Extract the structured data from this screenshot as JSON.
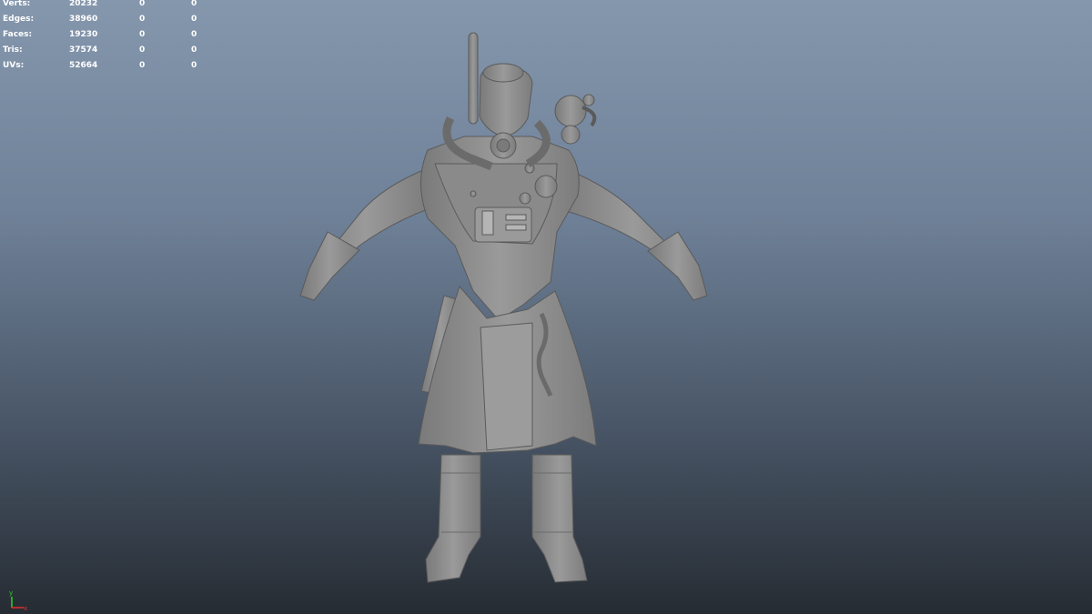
{
  "poly_count": {
    "rows": [
      {
        "label": "Verts:",
        "c1": "20232",
        "c2": "0",
        "c3": "0"
      },
      {
        "label": "Edges:",
        "c1": "38960",
        "c2": "0",
        "c3": "0"
      },
      {
        "label": "Faces:",
        "c1": "19230",
        "c2": "0",
        "c3": "0"
      },
      {
        "label": "Tris:",
        "c1": "37574",
        "c2": "0",
        "c3": "0"
      },
      {
        "label": "UVs:",
        "c1": "52664",
        "c2": "0",
        "c3": "0"
      }
    ]
  },
  "axis": {
    "y_label": "y",
    "x_label": "x"
  },
  "colors": {
    "bg_top": "#8597ad",
    "bg_bottom": "#262c33",
    "model": "#8e8e8e",
    "axis_y": "#2bd12b",
    "axis_x": "#e03030"
  }
}
